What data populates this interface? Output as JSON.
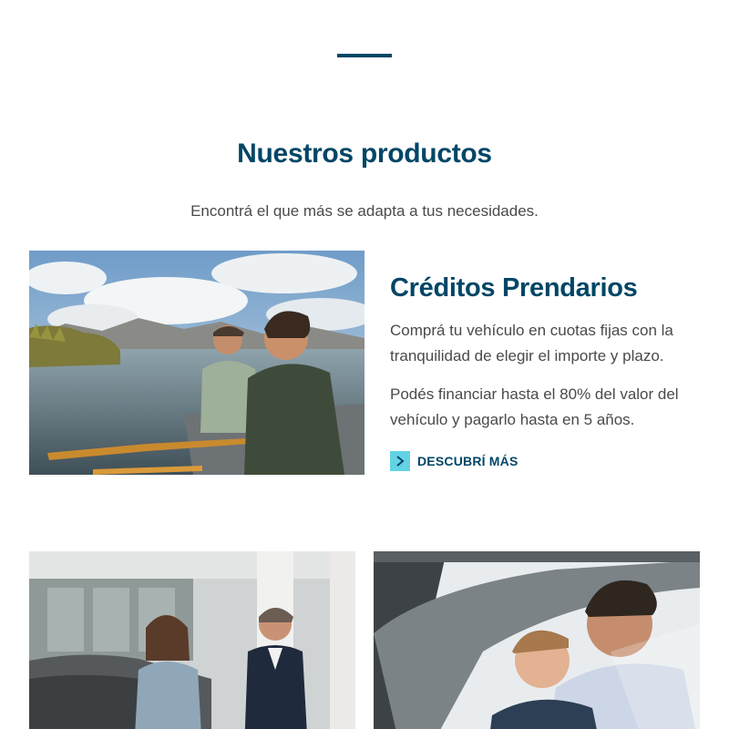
{
  "section": {
    "title": "Nuestros productos",
    "subtitle": "Encontrá el que más se adapta a tus necesidades."
  },
  "featured_product": {
    "title": "Créditos Prendarios",
    "paragraphs": [
      "Comprá tu vehículo en cuotas fijas con la tranquilidad de elegir el importe y plazo.",
      "Podés financiar hasta el 80% del valor del vehículo y pagarlo hasta en 5 años."
    ],
    "cta_label": "DESCUBRÍ MÁS",
    "cta_icon": "chevron-right-icon"
  },
  "colors": {
    "brand": "#004666",
    "accent": "#63d3e4",
    "body_text": "#4a4a4a"
  }
}
